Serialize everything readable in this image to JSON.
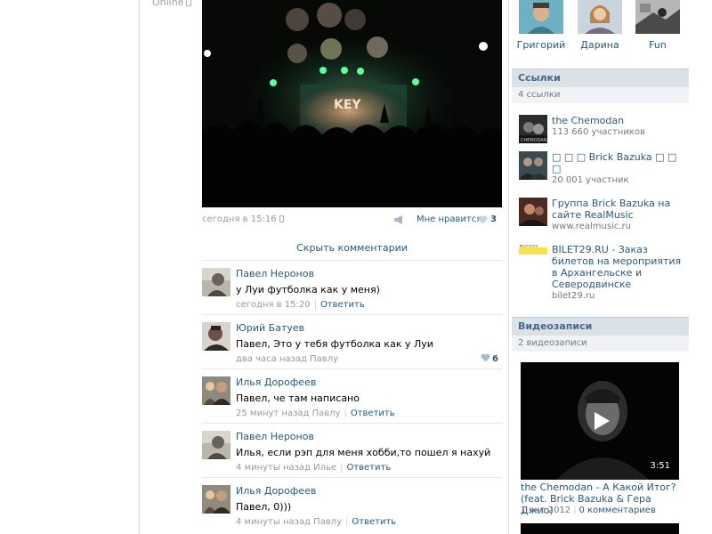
{
  "profile": {
    "online_status": "Online"
  },
  "post": {
    "time": "сегодня в 15:16",
    "like_label": "Мне нравится",
    "like_count": "3",
    "photo_text": "KEY"
  },
  "comments_toggle": "Скрыть комментарии",
  "comments": [
    {
      "author": "Павел Неронов",
      "text": "у Луи футболка как у меня)",
      "time": "сегодня в 15:20",
      "reply": "Ответить",
      "likes": ""
    },
    {
      "author": "Юрий Батуев",
      "text": "Павел, Это у тебя футболка как у Луи",
      "time": "два часа назад Павлу",
      "reply": "",
      "likes": "6"
    },
    {
      "author": "Илья Дорофеев",
      "text": "Павел, че там написано",
      "time": "25 минут назад Павлу",
      "reply": "Ответить",
      "likes": ""
    },
    {
      "author": "Павел Неронов",
      "text": "Илья, если рэп для меня хобби,то пошел я нахуй",
      "time": "4 минуты назад Илье",
      "reply": "Ответить",
      "likes": ""
    },
    {
      "author": "Илья Дорофеев",
      "text": "Павел, 0)))",
      "time": "4 минуты назад Павлу",
      "reply": "Ответить",
      "likes": ""
    }
  ],
  "friends": [
    {
      "name": "Григорий"
    },
    {
      "name": "Дарина"
    },
    {
      "name": "Fun"
    }
  ],
  "links_block": {
    "title": "Ссылки",
    "count": "4 ссылки",
    "items": [
      {
        "title": "the Chemodan",
        "sub": "113 660 участников",
        "thumb_text": "CHEMODAN"
      },
      {
        "title": "□ □ □ Brick Bazuka □ □ □",
        "sub": "20 001 участник",
        "thumb_text": ""
      },
      {
        "title": "Группа Brick Bazuka на сайте RealMusic",
        "sub": "www.realmusic.ru",
        "thumb_text": ""
      },
      {
        "title": "BILET29.RU - Заказ билетов на мероприятия в Архангельске и Северодвинске",
        "sub": "bilet29.ru",
        "thumb_text": "BILET29.RU"
      }
    ]
  },
  "videos_block": {
    "title": "Видеозаписи",
    "count": "2 видеозаписи",
    "video": {
      "duration": "3:51",
      "title": "the Chemodan - А Какой Итог? (feat. Brick Bazuka & Гера Джио)",
      "date": "1 окт 2012",
      "comments": "0 комментариев"
    }
  },
  "colors": {
    "link": "#2B587A",
    "header_bg": "#DAE2E8",
    "subheader_bg": "#F0F2F5",
    "muted": "#999999",
    "divider": "#E4E8ED"
  }
}
